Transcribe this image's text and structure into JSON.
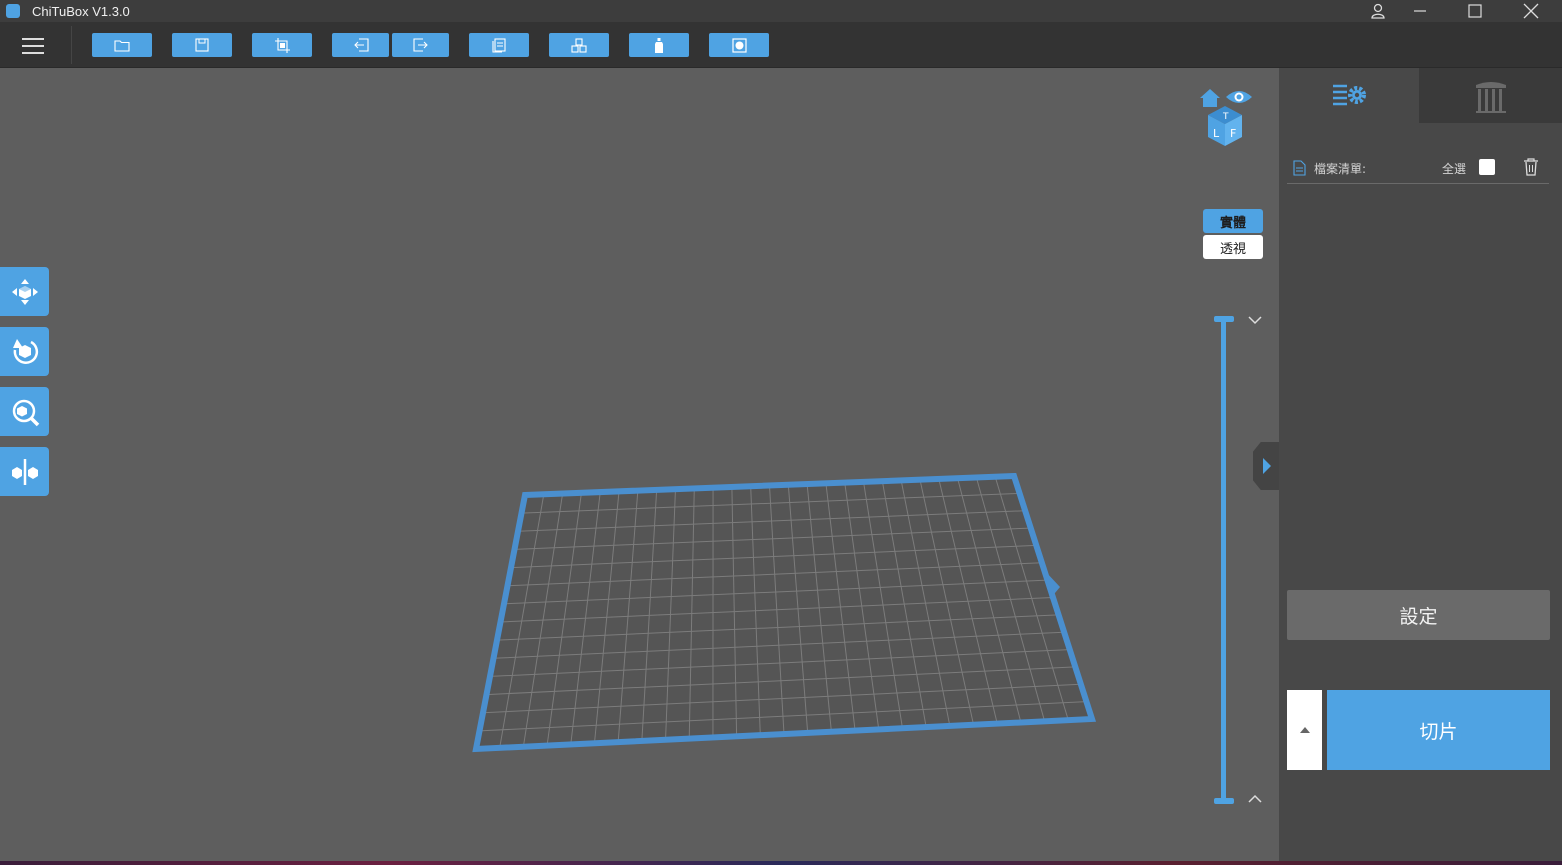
{
  "window": {
    "title": "ChiTuBox V1.3.0",
    "controls": [
      "user-icon",
      "minimize-icon",
      "maximize-icon",
      "close-icon"
    ]
  },
  "toolbar": {
    "buttons": [
      {
        "name": "open-file",
        "icon": "folder-icon"
      },
      {
        "name": "save",
        "icon": "save-icon"
      },
      {
        "name": "crop",
        "icon": "crop-icon"
      },
      {
        "name": "undo",
        "icon": "undo-icon"
      },
      {
        "name": "redo",
        "icon": "redo-icon"
      },
      {
        "name": "copy",
        "icon": "copy-icon"
      },
      {
        "name": "auto-layout",
        "icon": "cubes-icon"
      },
      {
        "name": "hollow",
        "icon": "bottle-icon"
      },
      {
        "name": "drill",
        "icon": "square-hole-icon"
      }
    ]
  },
  "left_tools": [
    {
      "name": "move",
      "icon": "move-icon"
    },
    {
      "name": "rotate",
      "icon": "rotate-icon"
    },
    {
      "name": "scale",
      "icon": "scale-icon"
    },
    {
      "name": "mirror",
      "icon": "mirror-icon"
    }
  ],
  "view": {
    "cube_faces": [
      "T",
      "L",
      "F"
    ],
    "mode_solid": "實體",
    "mode_xray": "透視"
  },
  "right_panel": {
    "file_list_label": "檔案清單:",
    "select_all_label": "全選",
    "settings_button": "設定",
    "slice_button": "切片"
  },
  "colors": {
    "accent": "#4fa3e3",
    "viewport": "#5e5e5e",
    "panel": "#484848",
    "titlebar": "#3d3d3d"
  }
}
